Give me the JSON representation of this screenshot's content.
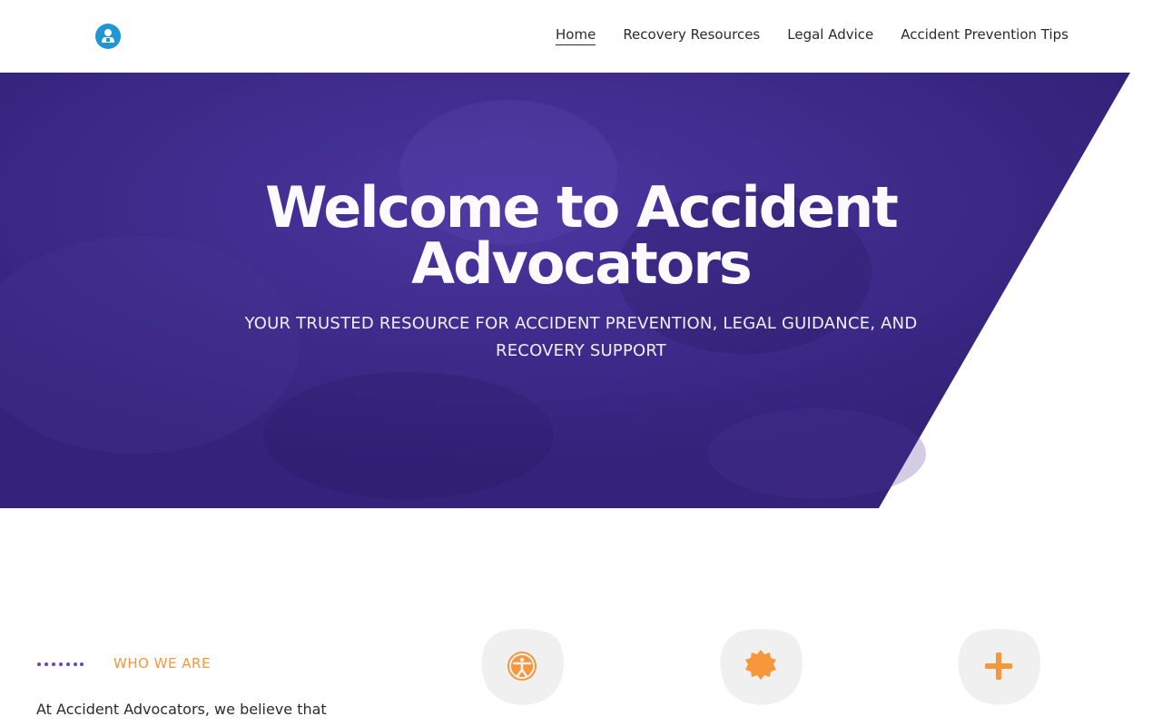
{
  "nav": {
    "items": [
      {
        "label": "Home",
        "active": true
      },
      {
        "label": "Recovery Resources",
        "active": false
      },
      {
        "label": "Legal Advice",
        "active": false
      },
      {
        "label": "Accident Prevention Tips",
        "active": false
      }
    ]
  },
  "hero": {
    "title": "Welcome to Accident Advocators",
    "subtitle": "YOUR TRUSTED RESOURCE FOR ACCIDENT PREVENTION, LEGAL GUIDANCE, AND RECOVERY SUPPORT"
  },
  "about": {
    "eyebrow": "WHO WE ARE",
    "intro": "At Accident Advocators, we believe that"
  },
  "features": [
    {
      "icon": "accessibility-icon"
    },
    {
      "icon": "badge-icon"
    },
    {
      "icon": "plus-icon"
    }
  ],
  "colors": {
    "brand_blue": "#1e97d4",
    "hero_purple": "#3a2885",
    "accent_orange": "#f5973a",
    "dot_purple": "#6a42c9",
    "icon_bg": "#f0f0f0"
  }
}
